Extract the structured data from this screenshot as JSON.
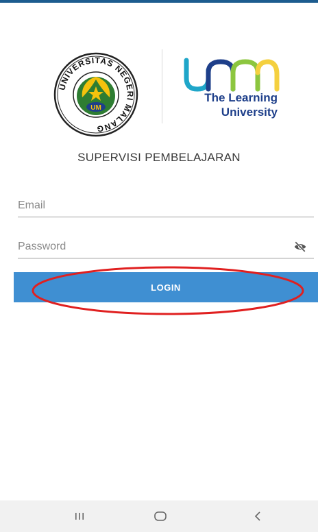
{
  "branding": {
    "seal_text": "UNIVERSITAS NEGERI MALANG",
    "seal_center": "UM",
    "tagline_line1": "The Learning",
    "tagline_line2": "University",
    "colors": {
      "um_blue": "#1e3f8a",
      "um_teal": "#1fa6c9",
      "um_green": "#8cc63f",
      "um_yellow": "#f4d03f"
    }
  },
  "app": {
    "title": "SUPERVISI PEMBELAJARAN"
  },
  "form": {
    "email": {
      "value": "",
      "placeholder": "Email"
    },
    "password": {
      "value": "",
      "placeholder": "Password",
      "toggle_icon": "eye-off-icon"
    },
    "login_label": "LOGIN",
    "button_color": "#3f8fd2"
  },
  "navbar": {
    "icons": [
      "recent-apps-icon",
      "home-icon",
      "back-icon"
    ]
  }
}
